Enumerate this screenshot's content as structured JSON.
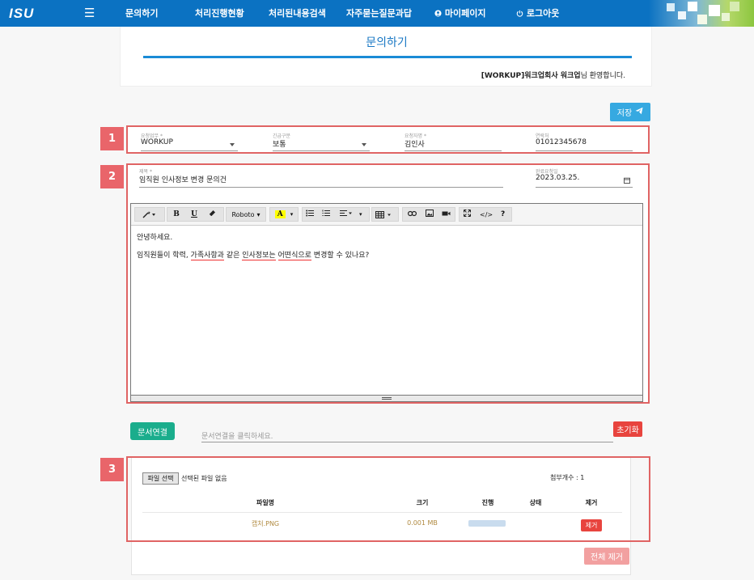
{
  "header": {
    "logo": "ISU",
    "menu_icon": "☰",
    "nav": [
      {
        "label": "문의하기"
      },
      {
        "label": "처리진행현황"
      },
      {
        "label": "처리된내용검색"
      },
      {
        "label": "자주묻는질문과답"
      },
      {
        "label": "마이페이지",
        "icon": "user-icon"
      },
      {
        "label": "로그아웃",
        "icon": "power-icon"
      }
    ]
  },
  "page": {
    "title": "문의하기",
    "welcome_user": "[WORKUP]워크업회사 워크업",
    "welcome_suffix": "님 환영합니다.",
    "save_label": "저장"
  },
  "section1": {
    "badge": "1",
    "fields": [
      {
        "label": "요청업무 *",
        "value": "WORKUP"
      },
      {
        "label": "긴급구분",
        "value": "보통"
      },
      {
        "label": "요청자명 *",
        "value": "김인사"
      },
      {
        "label": "연락처",
        "value": "01012345678"
      }
    ]
  },
  "section2": {
    "badge": "2",
    "subject_label": "제목 *",
    "subject_value": "임직원 인사정보 변경 문의건",
    "due_label": "완료요청일",
    "due_value": "2023.03.25.",
    "toolbar": {
      "font": "Roboto",
      "bold": "B",
      "underline": "U",
      "help": "?",
      "code": "</>"
    },
    "body": {
      "line1": "안녕하세요.",
      "line2_a": "임직원들이 학력, ",
      "line2_b": "가족사항과",
      "line2_c": " 같은 ",
      "line2_d": "인사정보는",
      "line2_e": " ",
      "line2_f": "어떤식으로",
      "line2_g": " 변경할 수 있나요?"
    }
  },
  "doclink": {
    "button": "문서연결",
    "placeholder": "문서연결을 클릭하세요.",
    "reset": "초기화"
  },
  "section3": {
    "badge": "3",
    "file_button": "파일 선택",
    "file_none": "선택된 파일 없음",
    "attach_count": "첨부개수 : 1",
    "columns": [
      "파일명",
      "크기",
      "진행",
      "상태",
      "제거"
    ],
    "rows": [
      {
        "name": "캡처.PNG",
        "size": "0.001 MB",
        "progress": 1.0,
        "status": "",
        "remove": "제거"
      }
    ],
    "remove_all": "전체 제거"
  },
  "colors": {
    "header": "#0b72c2",
    "accent": "#1a8bd6",
    "highlight_border": "#e06464",
    "doc_button": "#1aad8c",
    "danger": "#e8443e"
  }
}
